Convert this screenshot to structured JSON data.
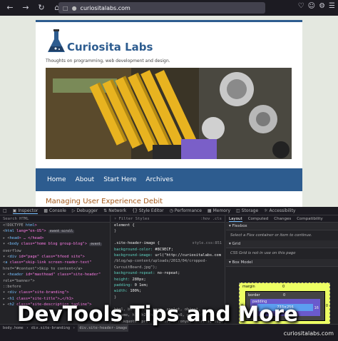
{
  "browser": {
    "url": "curiositalabs.com",
    "nav_icons": [
      "back-icon",
      "forward-icon",
      "reload-icon",
      "home-icon"
    ],
    "right_icons": [
      "pocket-icon",
      "account-icon",
      "extensions-icon",
      "menu-icon"
    ]
  },
  "site": {
    "title": "Curiosita Labs",
    "description": "Thoughts on programming, web development and design.",
    "nav": [
      "Home",
      "About",
      "Start Here",
      "Archives"
    ],
    "post_title": "Managing User Experience Debit",
    "accent": "#2d5c8f",
    "post_title_color": "#a45a1c"
  },
  "devtools": {
    "tabs": [
      "Inspector",
      "Console",
      "Debugger",
      "Network",
      "Style Editor",
      "Performance",
      "Memory",
      "Storage",
      "Accessibility"
    ],
    "active_tab": "Inspector",
    "html_search_placeholder": "Search HTML",
    "html_lines": [
      {
        "pre": "<!DOCTYPE ",
        "tag": "html",
        "rest": ">"
      },
      {
        "pre": "<",
        "tag": "html",
        "rest": " lang=\"en-US\">",
        "badge": "event  scroll"
      },
      {
        "pre": "  ▸ <",
        "tag": "head",
        "rest": "> … </head>"
      },
      {
        "pre": "  ▾ <",
        "tag": "body",
        "rest": " class=\"home blog group-blog\">",
        "badge": "event"
      },
      {
        "pre": "    ",
        "tag": "",
        "rest": "overflow"
      },
      {
        "pre": "    ▾ <",
        "tag": "div",
        "rest": " id=\"page\" class=\"hfeed site\">"
      },
      {
        "pre": "      <",
        "tag": "a",
        "rest": " class=\"skip-link screen-reader-text\""
      },
      {
        "pre": "        ",
        "tag": "",
        "rest": "href=\"#content\">Skip to content</a>"
      },
      {
        "pre": "      ▾ <",
        "tag": "header",
        "rest": " id=\"masthead\" class=\"site-header\""
      },
      {
        "pre": "        ",
        "tag": "",
        "rest": "role=\"banner\">"
      },
      {
        "pre": "        ",
        "tag": "",
        "rest": "::before"
      },
      {
        "pre": "      ▾ <",
        "tag": "div",
        "rest": " class=\"site-branding\">"
      },
      {
        "pre": "        ▸ <",
        "tag": "h1",
        "rest": " class=\"site-title\">…</h1>"
      },
      {
        "pre": "        ▸ <",
        "tag": "h2",
        "rest": " class=\"site-description tagline\">"
      }
    ],
    "rules_filter": "Filter Styles",
    "rules_toggles": [
      ":hov",
      ".cls"
    ],
    "rules_lines": [
      {
        "text": "element {",
        "kind": "sel"
      },
      {
        "text": "}",
        "kind": "plain"
      },
      {
        "text": "",
        "kind": "plain"
      },
      {
        "text": ".site-header-image {",
        "kind": "sel",
        "source": "style.css:851"
      },
      {
        "text": "  background-color: #8C9ECF;",
        "kind": "decl"
      },
      {
        "text": "  background-image: url(\"http://curiositalabs.com",
        "kind": "decl"
      },
      {
        "text": "    /blog/wp-content/uploads/2013/04/cropped-",
        "kind": "plain"
      },
      {
        "text": "    CurcuitBoard.jpg\");",
        "kind": "plain"
      },
      {
        "text": "  background-repeat: no-repeat;",
        "kind": "decl"
      },
      {
        "text": "  height: 280px;",
        "kind": "decl"
      },
      {
        "text": "  padding: 0 1em;",
        "kind": "decl"
      },
      {
        "text": "  width: 100%;",
        "kind": "decl"
      },
      {
        "text": "}",
        "kind": "plain"
      },
      {
        "text": "",
        "kind": "plain"
      },
      {
        "text": "html, body, div, span, applet, object,",
        "kind": "plain",
        "source": "style.css:36"
      },
      {
        "text": "iframe, h1, h2, h3, h4, h5, h6, p,",
        "kind": "plain"
      },
      {
        "text": "blockquote, pre, a, abbr, acronym, address, big,",
        "kind": "plain"
      },
      {
        "text": "cite, code, del, dfn, em, font, ins, kbd, q, s,",
        "kind": "plain"
      }
    ],
    "layout_tabs": [
      "Layout",
      "Computed",
      "Changes",
      "Compatibility"
    ],
    "layout_active": "Layout",
    "flexbox_title": "Flexbox",
    "flexbox_msg": "Select a Flex container or item to continue.",
    "grid_title": "Grid",
    "grid_msg": "CSS Grid is not in use on this page",
    "boxmodel_title": "Box Model",
    "boxmodel": {
      "margin": "margin",
      "border": "border",
      "padding": "padding",
      "content": "733×256",
      "padding_side": "16",
      "zero": "0"
    },
    "breadcrumbs": [
      "html",
      "body.home.blog.group-blog",
      "div#page.hfeed.site",
      "header#masthead.site-header",
      "div.site-branding",
      "div.site-header-image"
    ],
    "breadcrumbs_visible": [
      "body.home",
      "div.site-branding",
      "div.site-header-image"
    ]
  },
  "banner": {
    "headline": "DevTools Tips and More",
    "watermark": "curiositalabs.com"
  }
}
